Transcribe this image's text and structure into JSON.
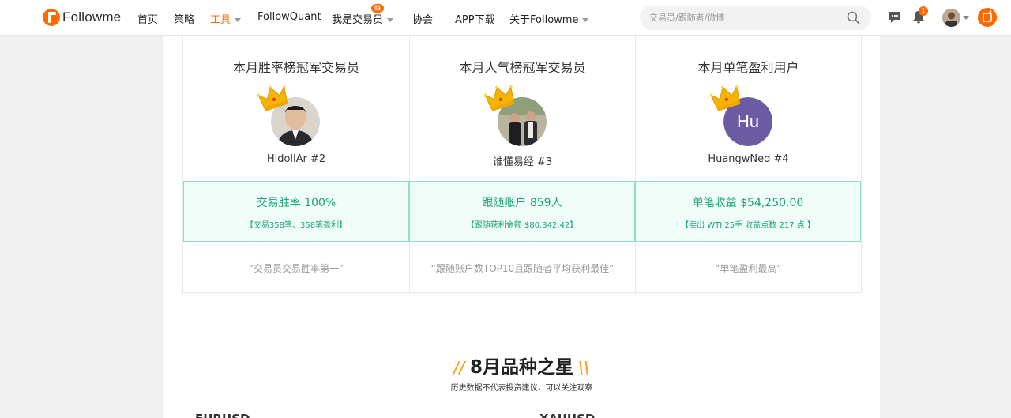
{
  "nav": {
    "logo_text": "Followme",
    "items": [
      "首页",
      "策略",
      "工具",
      "FollowQuant",
      "我是交易员",
      "协会",
      "APP下载",
      "关于Followme"
    ],
    "active": "工具",
    "hot_badge": "赚",
    "search_placeholder": "交易员/跟随者/微博",
    "notification_count": "1",
    "accent_color": "#ff6a00"
  },
  "champions": [
    {
      "title": "本月胜率榜冠军交易员",
      "name": "HidollAr #2",
      "stat_main": "交易胜率 100%",
      "stat_sub": "【交易358笔、358笔盈利】",
      "quote": "“交易员交易胜率第一”",
      "avatar": "photo"
    },
    {
      "title": "本月人气榜冠军交易员",
      "name": "谁懂易经 #3",
      "stat_main": "跟随账户 859人",
      "stat_sub": "【跟随获利金额 $80,342.42】",
      "quote": "“跟随账户数TOP10且跟随者平均获利最佳”",
      "avatar": "photo"
    },
    {
      "title": "本月单笔盈利用户",
      "name": "HuangwNed #4",
      "stat_main": "单笔收益 $54,250.00",
      "stat_sub": "【卖出 WTI 25手 收益点数 217 点 】",
      "quote": "“单笔盈利最高”",
      "avatar": "Hu"
    }
  ],
  "section": {
    "title": "8月品种之星",
    "subtitle": "历史数据不代表投资建议，可以关注观察",
    "left_slash": "//",
    "right_slash": "\\\\",
    "partial_left": "EURUSD",
    "partial_right": "XAUUSD"
  },
  "colors": {
    "stat_green": "#19a574",
    "stat_bg": "#f0fcf7",
    "initials_bg": "#6a5ba3",
    "crown": "#f5b400"
  }
}
